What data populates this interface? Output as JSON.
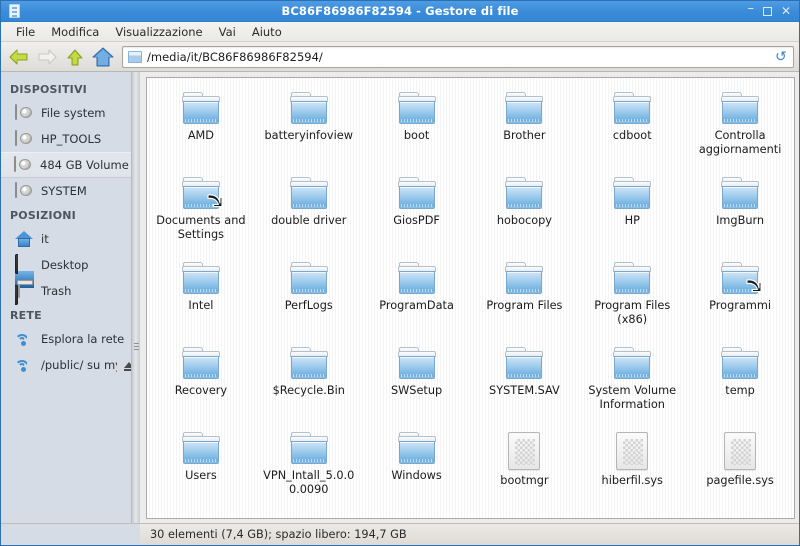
{
  "window": {
    "title": "BC86F86986F82594 - Gestore di file",
    "app_icon": "file-manager-icon",
    "minimize_label": "–",
    "maximize_label": "",
    "close_label": "✕"
  },
  "menubar": {
    "items": [
      {
        "label": "File"
      },
      {
        "label": "Modifica"
      },
      {
        "label": "Visualizzazione"
      },
      {
        "label": "Vai"
      },
      {
        "label": "Aiuto"
      }
    ]
  },
  "toolbar": {
    "back_icon": "arrow-left-icon",
    "forward_icon": "arrow-right-icon",
    "up_icon": "arrow-up-icon",
    "home_icon": "home-icon",
    "path_icon": "folder-small-icon",
    "path_value": "/media/it/BC86F86986F82594/",
    "refresh_icon": "↻",
    "refresh_color": "#3b84d0"
  },
  "sidebar": {
    "groups": [
      {
        "title": "DISPOSITIVI",
        "items": [
          {
            "label": "File system",
            "icon": "drive-icon",
            "selected": false,
            "eject": false
          },
          {
            "label": "HP_TOOLS",
            "icon": "drive-icon",
            "selected": false,
            "eject": false
          },
          {
            "label": "484 GB Volume",
            "icon": "drive-icon",
            "selected": true,
            "eject": false
          },
          {
            "label": "SYSTEM",
            "icon": "drive-icon",
            "selected": false,
            "eject": false
          }
        ]
      },
      {
        "title": "POSIZIONI",
        "items": [
          {
            "label": "it",
            "icon": "home-icon",
            "selected": false,
            "eject": false
          },
          {
            "label": "Desktop",
            "icon": "monitor-icon",
            "selected": false,
            "eject": false
          },
          {
            "label": "Trash",
            "icon": "trash-icon",
            "selected": false,
            "eject": false
          }
        ]
      },
      {
        "title": "RETE",
        "items": [
          {
            "label": "Esplora la rete",
            "icon": "network-icon",
            "selected": false,
            "eject": false
          },
          {
            "label": "/public/ su my…",
            "icon": "network-icon",
            "selected": false,
            "eject": true
          }
        ]
      }
    ]
  },
  "files": [
    {
      "name": "AMD",
      "type": "folder",
      "link": false
    },
    {
      "name": "batteryinfoview",
      "type": "folder",
      "link": false
    },
    {
      "name": "boot",
      "type": "folder",
      "link": false
    },
    {
      "name": "Brother",
      "type": "folder",
      "link": false
    },
    {
      "name": "cdboot",
      "type": "folder",
      "link": false
    },
    {
      "name": "Controlla aggiornamenti",
      "type": "folder",
      "link": false
    },
    {
      "name": "Documents and Settings",
      "type": "folder",
      "link": true
    },
    {
      "name": "double driver",
      "type": "folder",
      "link": false
    },
    {
      "name": "GiosPDF",
      "type": "folder",
      "link": false
    },
    {
      "name": "hobocopy",
      "type": "folder",
      "link": false
    },
    {
      "name": "HP",
      "type": "folder",
      "link": false
    },
    {
      "name": "ImgBurn",
      "type": "folder",
      "link": false
    },
    {
      "name": "Intel",
      "type": "folder",
      "link": false
    },
    {
      "name": "PerfLogs",
      "type": "folder",
      "link": false
    },
    {
      "name": "ProgramData",
      "type": "folder",
      "link": false
    },
    {
      "name": "Program Files",
      "type": "folder",
      "link": false
    },
    {
      "name": "Program Files (x86)",
      "type": "folder",
      "link": false
    },
    {
      "name": "Programmi",
      "type": "folder",
      "link": true
    },
    {
      "name": "Recovery",
      "type": "folder",
      "link": false
    },
    {
      "name": "$Recycle.Bin",
      "type": "folder",
      "link": false
    },
    {
      "name": "SWSetup",
      "type": "folder",
      "link": false
    },
    {
      "name": "SYSTEM.SAV",
      "type": "folder",
      "link": false
    },
    {
      "name": "System Volume Information",
      "type": "folder",
      "link": false
    },
    {
      "name": "temp",
      "type": "folder",
      "link": false
    },
    {
      "name": "Users",
      "type": "folder",
      "link": false
    },
    {
      "name": "VPN_Intall_5.0.00.0090",
      "type": "folder",
      "link": false
    },
    {
      "name": "Windows",
      "type": "folder",
      "link": false
    },
    {
      "name": "bootmgr",
      "type": "file",
      "link": false
    },
    {
      "name": "hiberfil.sys",
      "type": "file",
      "link": false
    },
    {
      "name": "pagefile.sys",
      "type": "file",
      "link": false
    }
  ],
  "statusbar": {
    "text": "30 elementi (7,4 GB); spazio libero: 194,7 GB"
  },
  "colors": {
    "titlebar": "#3a8bd8",
    "sidebar": "#d5dce6",
    "accent": "#3b84d0",
    "folder": "#8cc0e6"
  }
}
